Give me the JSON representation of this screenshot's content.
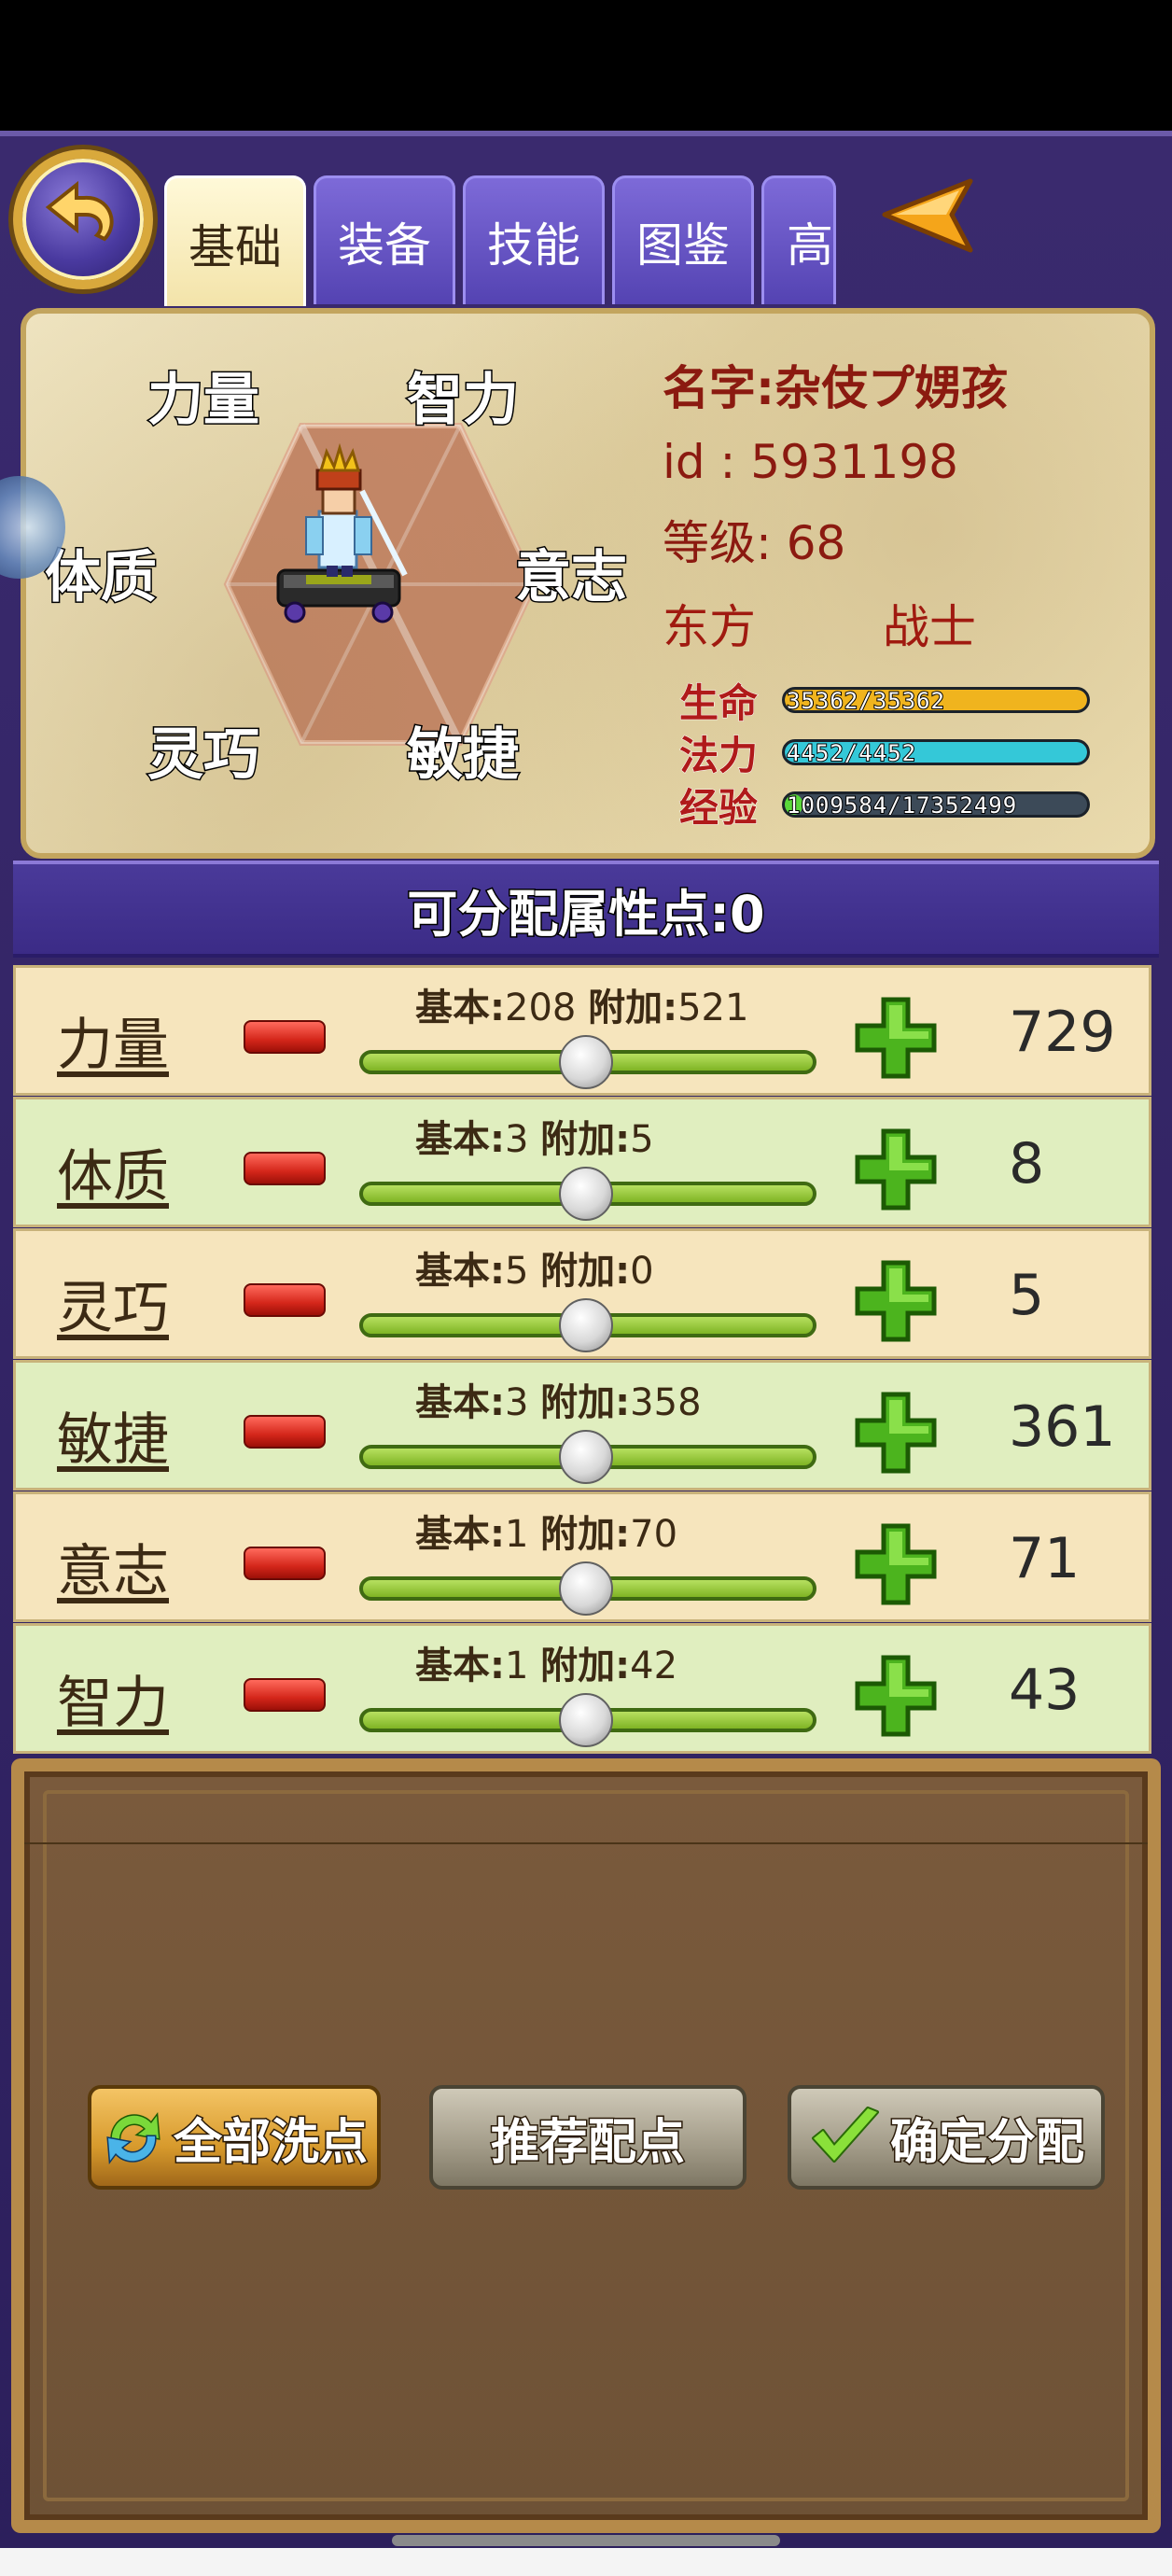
{
  "tabs": [
    {
      "label": "基础",
      "active": true
    },
    {
      "label": "装备",
      "active": false
    },
    {
      "label": "技能",
      "active": false
    },
    {
      "label": "图鉴",
      "active": false
    },
    {
      "label": "高",
      "active": false
    }
  ],
  "hexagon": {
    "strength": "力量",
    "intellect": "智力",
    "constitution": "体质",
    "will": "意志",
    "dexterity": "灵巧",
    "agility": "敏捷"
  },
  "character": {
    "name_text": "名字:杂伎プ娚孩",
    "id_text": "id : 5931198",
    "level_text": "等级: 68",
    "faction": "东方",
    "class": "战士"
  },
  "bars": [
    {
      "label": "生命",
      "text": "35362/35362",
      "fraction": 1.0,
      "color": "#f0b41e"
    },
    {
      "label": "法力",
      "text": "4452/4452",
      "fraction": 1.0,
      "color": "#34c8d8"
    },
    {
      "label": "经验",
      "text": "1009584/17352499",
      "fraction": 0.058,
      "color": "#5ad83a"
    }
  ],
  "points": {
    "text": "可分配属性点:0"
  },
  "stats": [
    {
      "name": "力量",
      "base_label": "基本:",
      "base": "208",
      "add_label": "附加:",
      "add": "521",
      "total": "729"
    },
    {
      "name": "体质",
      "base_label": "基本:",
      "base": "3",
      "add_label": "附加:",
      "add": "5",
      "total": "8"
    },
    {
      "name": "灵巧",
      "base_label": "基本:",
      "base": "5",
      "add_label": "附加:",
      "add": "0",
      "total": "5"
    },
    {
      "name": "敏捷",
      "base_label": "基本:",
      "base": "3",
      "add_label": "附加:",
      "add": "358",
      "total": "361"
    },
    {
      "name": "意志",
      "base_label": "基本:",
      "base": "1",
      "add_label": "附加:",
      "add": "70",
      "total": "71"
    },
    {
      "name": "智力",
      "base_label": "基本:",
      "base": "1",
      "add_label": "附加:",
      "add": "42",
      "total": "43"
    }
  ],
  "buttons": {
    "reset": "全部洗点",
    "recommend": "推荐配点",
    "confirm": "确定分配"
  },
  "icons": {
    "back": "back-arrow-icon",
    "nav": "left-arrow-icon",
    "reset": "refresh-icon",
    "confirm": "checkmark-icon"
  }
}
